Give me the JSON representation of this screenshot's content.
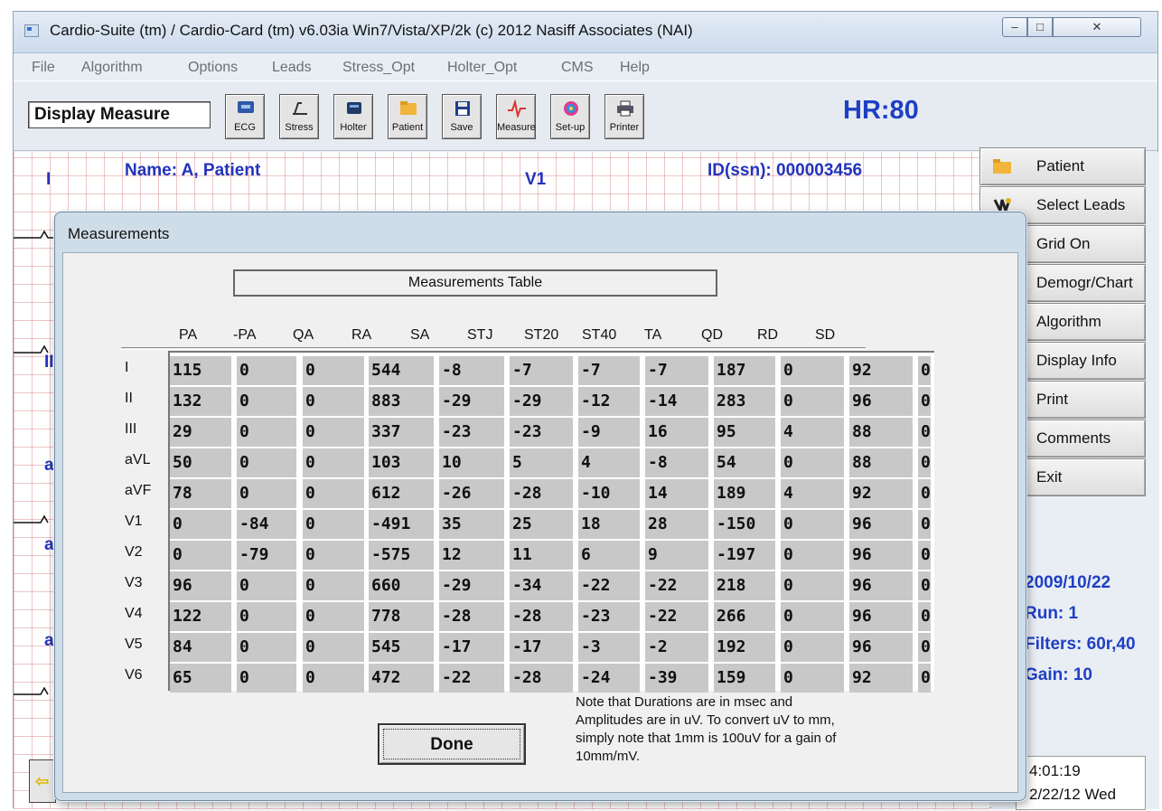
{
  "window": {
    "title": "Cardio-Suite (tm) / Cardio-Card (tm) v6.03ia Win7/Vista/XP/2k (c) 2012 Nasiff Associates (NAI)"
  },
  "menu": [
    "File",
    "Algorithm",
    "Options",
    "Leads",
    "Stress_Opt",
    "Holter_Opt",
    "CMS",
    "Help"
  ],
  "toolbar": {
    "mode_label": "Display Measure",
    "buttons": [
      {
        "label": "ECG",
        "icon": "ecg-icon"
      },
      {
        "label": "Stress",
        "icon": "treadmill-icon"
      },
      {
        "label": "Holter",
        "icon": "holter-icon"
      },
      {
        "label": "Patient",
        "icon": "folder-icon"
      },
      {
        "label": "Save",
        "icon": "floppy-disk-icon"
      },
      {
        "label": "Measure",
        "icon": "waveform-icon"
      },
      {
        "label": "Set-up",
        "icon": "color-wheel-icon"
      },
      {
        "label": "Printer",
        "icon": "printer-icon"
      }
    ],
    "hr": "HR:80"
  },
  "ecg": {
    "lead_labels": [
      "I",
      "II",
      "a",
      "a",
      "a"
    ],
    "name": "Name: A, Patient",
    "v1_label": "V1",
    "id": "ID(ssn): 000003456"
  },
  "side_buttons": [
    {
      "label": "Patient",
      "icon": "folder-icon"
    },
    {
      "label": "Select Leads",
      "icon": "leads-icon"
    },
    {
      "label": "Grid On",
      "icon": "grid-icon"
    },
    {
      "label": "Demogr/Chart",
      "icon": "chart-icon"
    },
    {
      "label": "Algorithm",
      "icon": "waveform-icon"
    },
    {
      "label": "Display Info",
      "icon": "info-icon"
    },
    {
      "label": "Print",
      "icon": "printer-icon"
    },
    {
      "label": "Comments",
      "icon": "comments-icon"
    },
    {
      "label": "Exit",
      "icon": "power-icon"
    }
  ],
  "info": {
    "date": "2009/10/22",
    "run": "Run: 1",
    "filters": "Filters: 60r,40",
    "gain": "Gain: 10",
    "time": "4:01:19",
    "datetime": "2/22/12 Wed"
  },
  "dialog": {
    "title": "Measurements",
    "table_title": "Measurements Table",
    "columns": [
      "PA",
      "-PA",
      "QA",
      "RA",
      "SA",
      "STJ",
      "ST20",
      "ST40",
      "TA",
      "QD",
      "RD",
      "SD"
    ],
    "rows": [
      {
        "lead": "I",
        "values": [
          "115",
          "0",
          "0",
          "544",
          "-8",
          "-7",
          "-7",
          "-7",
          "187",
          "0",
          "92",
          "0"
        ]
      },
      {
        "lead": "II",
        "values": [
          "132",
          "0",
          "0",
          "883",
          "-29",
          "-29",
          "-12",
          "-14",
          "283",
          "0",
          "96",
          "0"
        ]
      },
      {
        "lead": "III",
        "values": [
          "29",
          "0",
          "0",
          "337",
          "-23",
          "-23",
          "-9",
          "16",
          "95",
          "4",
          "88",
          "0"
        ]
      },
      {
        "lead": "aVL",
        "values": [
          "50",
          "0",
          "0",
          "103",
          "10",
          "5",
          "4",
          "-8",
          "54",
          "0",
          "88",
          "0"
        ]
      },
      {
        "lead": "aVF",
        "values": [
          "78",
          "0",
          "0",
          "612",
          "-26",
          "-28",
          "-10",
          "14",
          "189",
          "4",
          "92",
          "0"
        ]
      },
      {
        "lead": "V1",
        "values": [
          "0",
          "-84",
          "0",
          "-491",
          "35",
          "25",
          "18",
          "28",
          "-150",
          "0",
          "96",
          "0"
        ]
      },
      {
        "lead": "V2",
        "values": [
          "0",
          "-79",
          "0",
          "-575",
          "12",
          "11",
          "6",
          "9",
          "-197",
          "0",
          "96",
          "0"
        ]
      },
      {
        "lead": "V3",
        "values": [
          "96",
          "0",
          "0",
          "660",
          "-29",
          "-34",
          "-22",
          "-22",
          "218",
          "0",
          "96",
          "0"
        ]
      },
      {
        "lead": "V4",
        "values": [
          "122",
          "0",
          "0",
          "778",
          "-28",
          "-28",
          "-23",
          "-22",
          "266",
          "0",
          "96",
          "0"
        ]
      },
      {
        "lead": "V5",
        "values": [
          "84",
          "0",
          "0",
          "545",
          "-17",
          "-17",
          "-3",
          "-2",
          "192",
          "0",
          "96",
          "0"
        ]
      },
      {
        "lead": "V6",
        "values": [
          "65",
          "0",
          "0",
          "472",
          "-22",
          "-28",
          "-24",
          "-39",
          "159",
          "0",
          "92",
          "0"
        ]
      }
    ],
    "done_label": "Done",
    "note": [
      "Note that Durations are in msec and",
      "Amplitudes are in uV. To convert uV to mm,",
      "simply note that 1mm is 100uV for a gain of",
      "10mm/mV."
    ]
  }
}
